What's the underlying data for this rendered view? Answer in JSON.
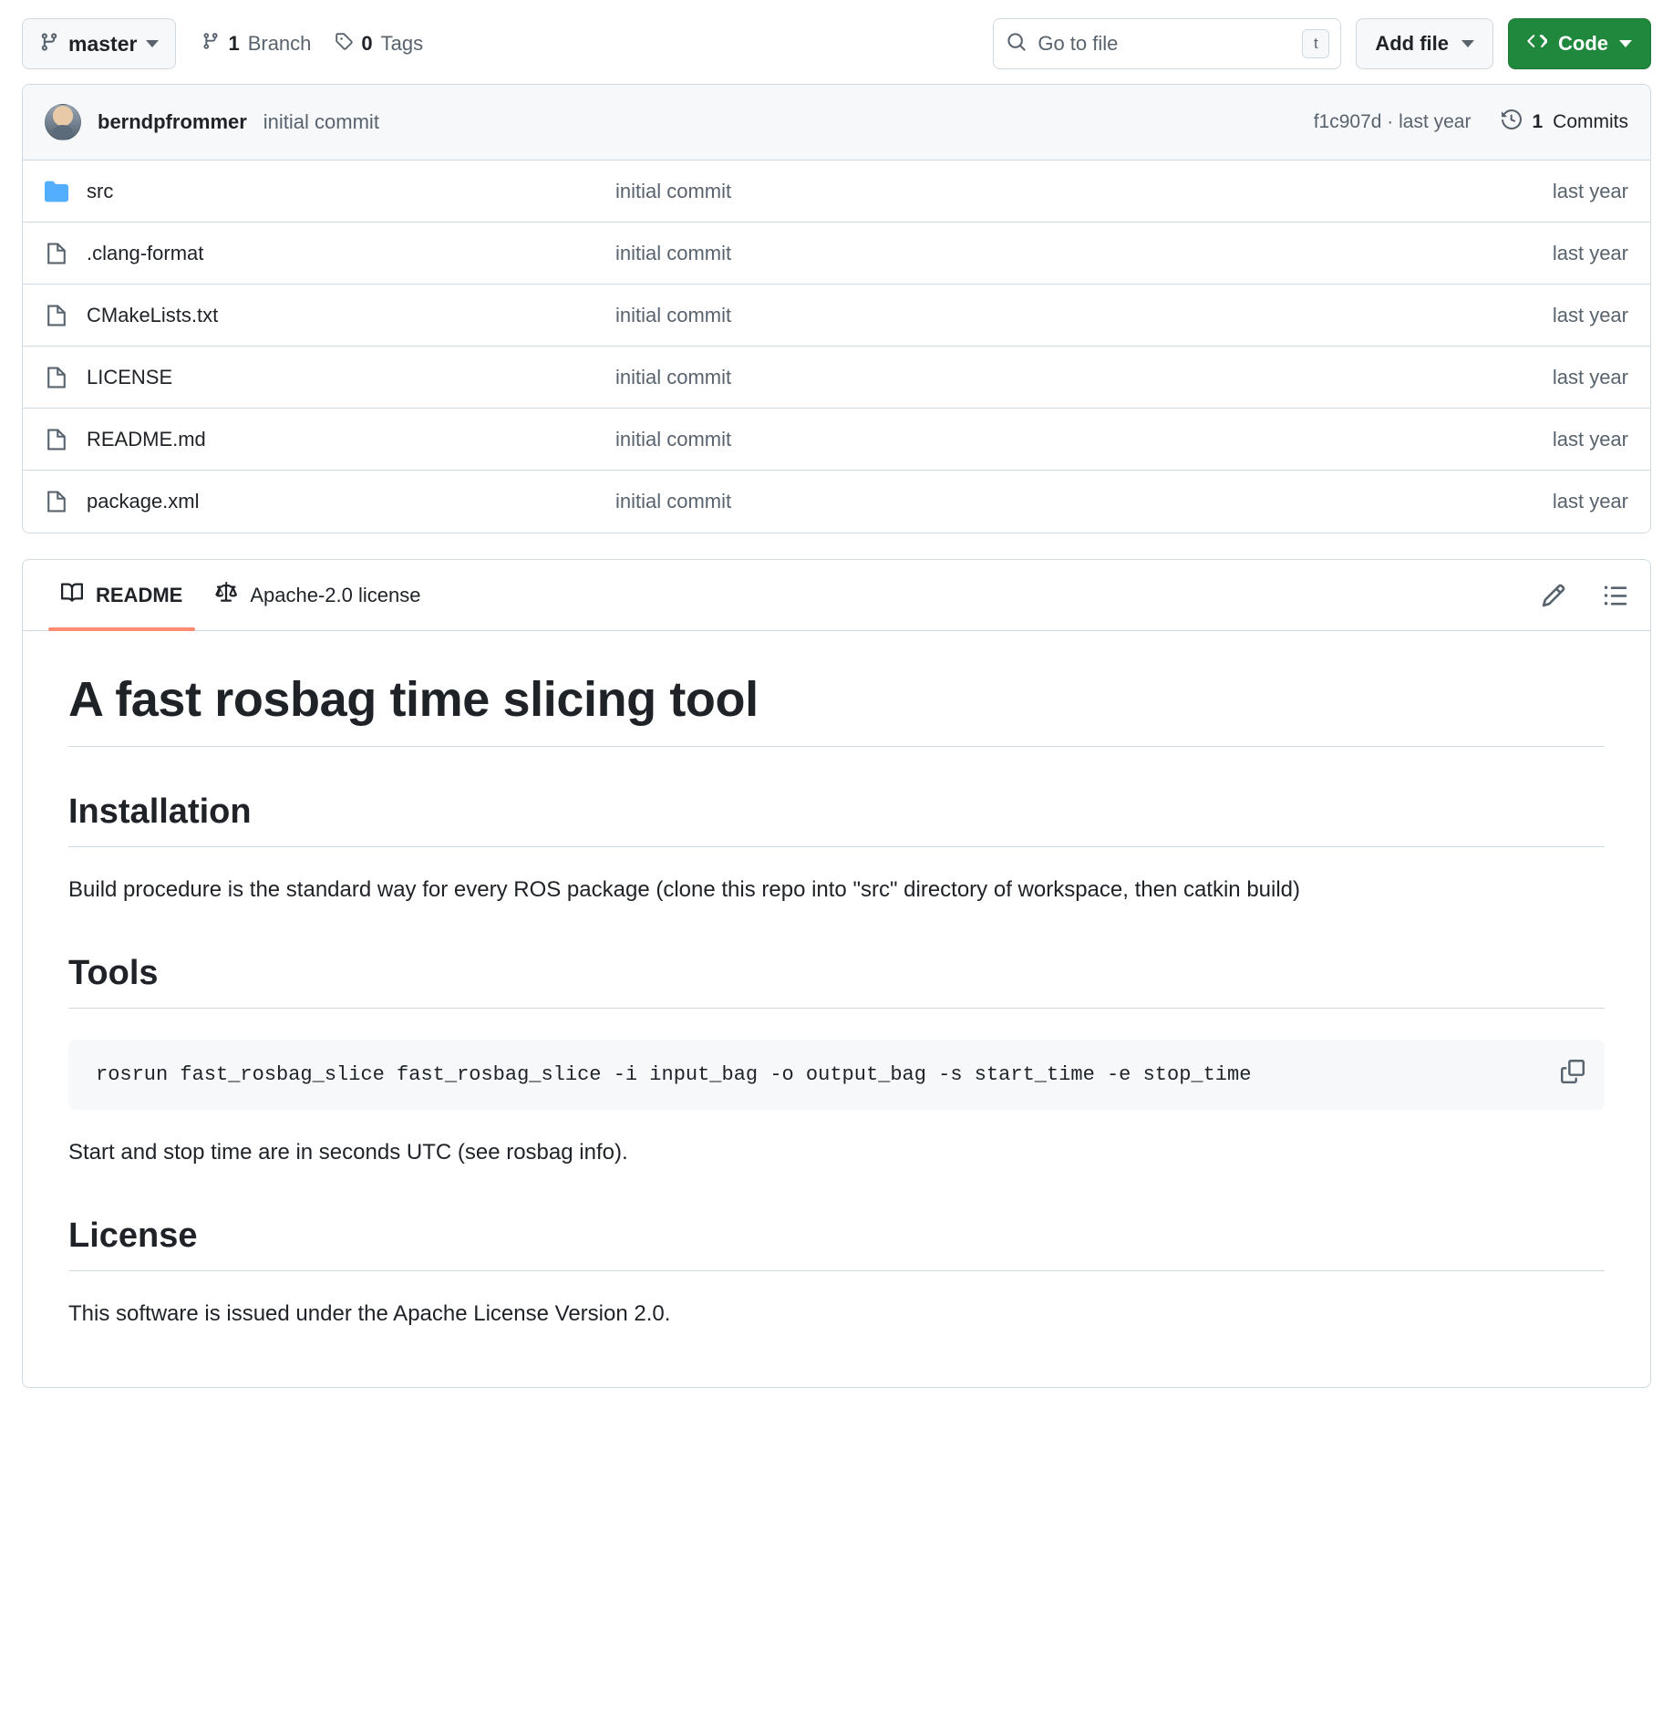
{
  "toolbar": {
    "branch_name": "master",
    "branches_count": "1",
    "branches_label": "Branch",
    "tags_count": "0",
    "tags_label": "Tags",
    "search_placeholder": "Go to file",
    "search_value": "",
    "search_kbd": "t",
    "add_file_label": "Add file",
    "code_label": "Code",
    "code_button_color": "#1f883d"
  },
  "commit_bar": {
    "author": "berndpfrommer",
    "message": "initial commit",
    "hash_and_time": "f1c907d · last year",
    "commits_count": "1",
    "commits_label": "Commits"
  },
  "files": [
    {
      "name": "src",
      "type": "folder",
      "message": "initial commit",
      "time": "last year"
    },
    {
      "name": ".clang-format",
      "type": "file",
      "message": "initial commit",
      "time": "last year"
    },
    {
      "name": "CMakeLists.txt",
      "type": "file",
      "message": "initial commit",
      "time": "last year"
    },
    {
      "name": "LICENSE",
      "type": "file",
      "message": "initial commit",
      "time": "last year"
    },
    {
      "name": "README.md",
      "type": "file",
      "message": "initial commit",
      "time": "last year"
    },
    {
      "name": "package.xml",
      "type": "file",
      "message": "initial commit",
      "time": "last year"
    }
  ],
  "readme": {
    "tab_readme": "README",
    "tab_license": "Apache-2.0 license",
    "active_tab_underline_color": "#fd8c73",
    "title": "A fast rosbag time slicing tool",
    "installation_heading": "Installation",
    "installation_text": "Build procedure is the standard way for every ROS package (clone this repo into \"src\" directory of workspace, then catkin build)",
    "tools_heading": "Tools",
    "tools_code": "rosrun fast_rosbag_slice fast_rosbag_slice -i input_bag -o output_bag -s start_time -e stop_time",
    "tools_note": "Start and stop time are in seconds UTC (see rosbag info).",
    "license_heading": "License",
    "license_text": "This software is issued under the Apache License Version 2.0."
  }
}
